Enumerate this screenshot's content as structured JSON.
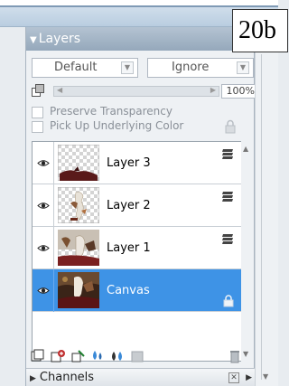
{
  "overlay_label": "20b",
  "panel": {
    "title": "Layers",
    "blend_mode": "Default",
    "composite": "Ignore",
    "opacity": "100%",
    "preserve_transparency": "Preserve Transparency",
    "pick_up_underlying": "Pick Up Underlying Color"
  },
  "layers": [
    {
      "name": "Layer 3",
      "visible": true,
      "selected": false
    },
    {
      "name": "Layer 2",
      "visible": true,
      "selected": false
    },
    {
      "name": "Layer 1",
      "visible": true,
      "selected": false
    },
    {
      "name": "Canvas",
      "visible": true,
      "selected": true,
      "locked": true
    }
  ],
  "toolbar_icons": [
    "layer-group-icon",
    "new-layer-icon",
    "tracing-layer-icon",
    "water-layer-icon",
    "wet-layer-icon",
    "mask-icon",
    "trash-icon"
  ],
  "channels": {
    "title": "Channels"
  },
  "colors": {
    "selection": "#3e93e6",
    "header": "#95a8bb"
  }
}
